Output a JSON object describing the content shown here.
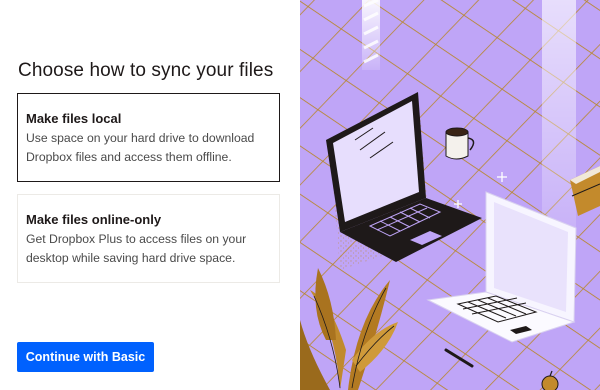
{
  "heading": "Choose how to sync your files",
  "options": [
    {
      "title": "Make files local",
      "description": "Use space on your hard drive to download Dropbox files and access them offline.",
      "selected": true
    },
    {
      "title": "Make files online-only",
      "description": "Get Dropbox Plus to access files on your desktop while saving hard drive space.",
      "selected": false
    }
  ],
  "primary_button": "Continue with Basic",
  "colors": {
    "accent": "#0061fe",
    "illustration_background": "#bfa5f7",
    "grid_lines": "#b8872e",
    "text_primary": "#1e1919"
  },
  "illustration": {
    "icons": [
      "dark-laptop-icon",
      "white-laptop-icon",
      "coffee-mug-icon",
      "plant-icon",
      "book-stack-icon",
      "pen-icon",
      "apple-icon"
    ]
  }
}
